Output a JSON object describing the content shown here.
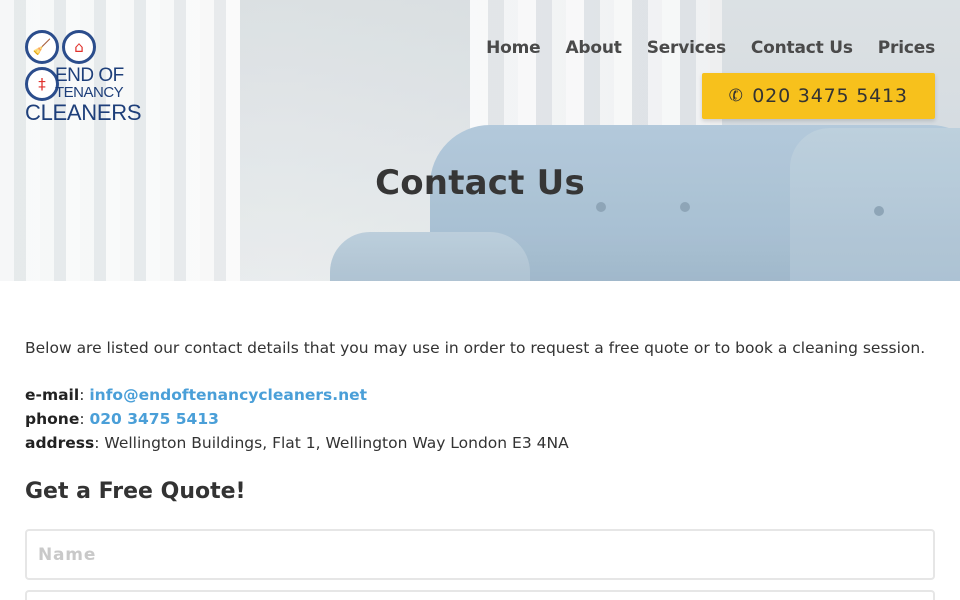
{
  "logo": {
    "line1": "END OF",
    "line2": "TENANCY",
    "line3": "CLEANERS",
    "icons": [
      "broom-icon",
      "house-icon",
      "spray-bottle-icon"
    ]
  },
  "nav": {
    "items": [
      "Home",
      "About",
      "Services",
      "Contact Us",
      "Prices"
    ]
  },
  "header": {
    "phone_label": "020 3475 5413",
    "phone_icon": "phone-icon"
  },
  "hero": {
    "title": "Contact Us"
  },
  "content": {
    "intro": "Below are listed our contact details that you may use in order to request a free quote or to book a cleaning session.",
    "email_label": "e-mail",
    "email_value": "info@endoftenancycleaners.net",
    "phone_label": "phone",
    "phone_value": "020 3475 5413",
    "address_label": "address",
    "address_value": "Wellington Buildings, Flat 1, Wellington Way London E3 4NA",
    "separator": ":"
  },
  "form": {
    "title": "Get a Free Quote!",
    "name_placeholder": "Name"
  },
  "colors": {
    "accent_yellow": "#f7c11c",
    "link_blue": "#4a9fd8",
    "logo_navy": "#1e3f7a",
    "logo_red": "#e0322d"
  }
}
